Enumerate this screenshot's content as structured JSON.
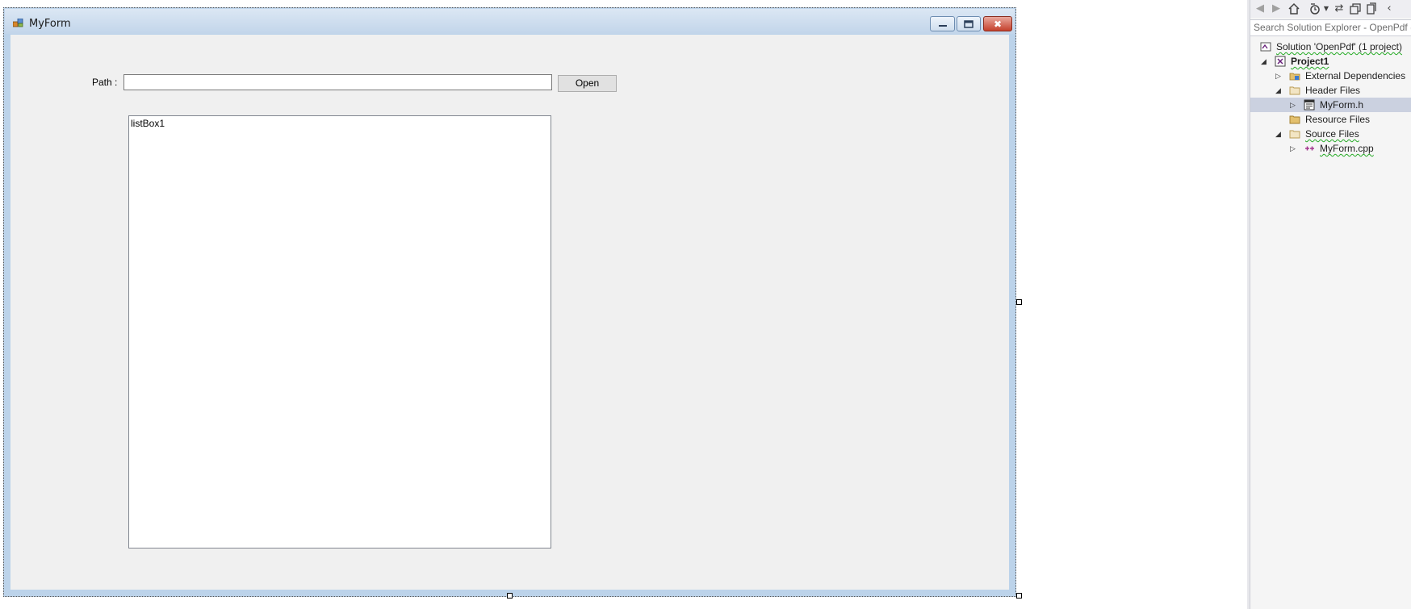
{
  "form": {
    "title": "MyForm",
    "path_label": "Path :",
    "path_value": "",
    "open_button_label": "Open",
    "listbox_item": "listBox1"
  },
  "window_controls": {
    "close_glyph": "✖"
  },
  "solution_explorer": {
    "search_placeholder": "Search Solution Explorer - OpenPdf (Ctrl+;)",
    "tree": [
      {
        "label": "Solution 'OpenPdf' (1 project)",
        "icon": "solution-icon"
      },
      {
        "label": "Project1",
        "icon": "project-icon"
      },
      {
        "label": "External Dependencies",
        "icon": "external-deps-icon"
      },
      {
        "label": "Header Files",
        "icon": "folder-icon"
      },
      {
        "label": "MyForm.h",
        "icon": "form-file-icon",
        "selected": true
      },
      {
        "label": "Resource Files",
        "icon": "folder-icon"
      },
      {
        "label": "Source Files",
        "icon": "folder-icon"
      },
      {
        "label": "MyForm.cpp",
        "icon": "cpp-file-icon"
      }
    ]
  },
  "colors": {
    "form_background": "#f0f0f0",
    "title_bar": "#c2d5ea",
    "close_button": "#c5412c",
    "selected_row": "#cbd1e0",
    "spell_check_squiggle": "#22aa22"
  }
}
